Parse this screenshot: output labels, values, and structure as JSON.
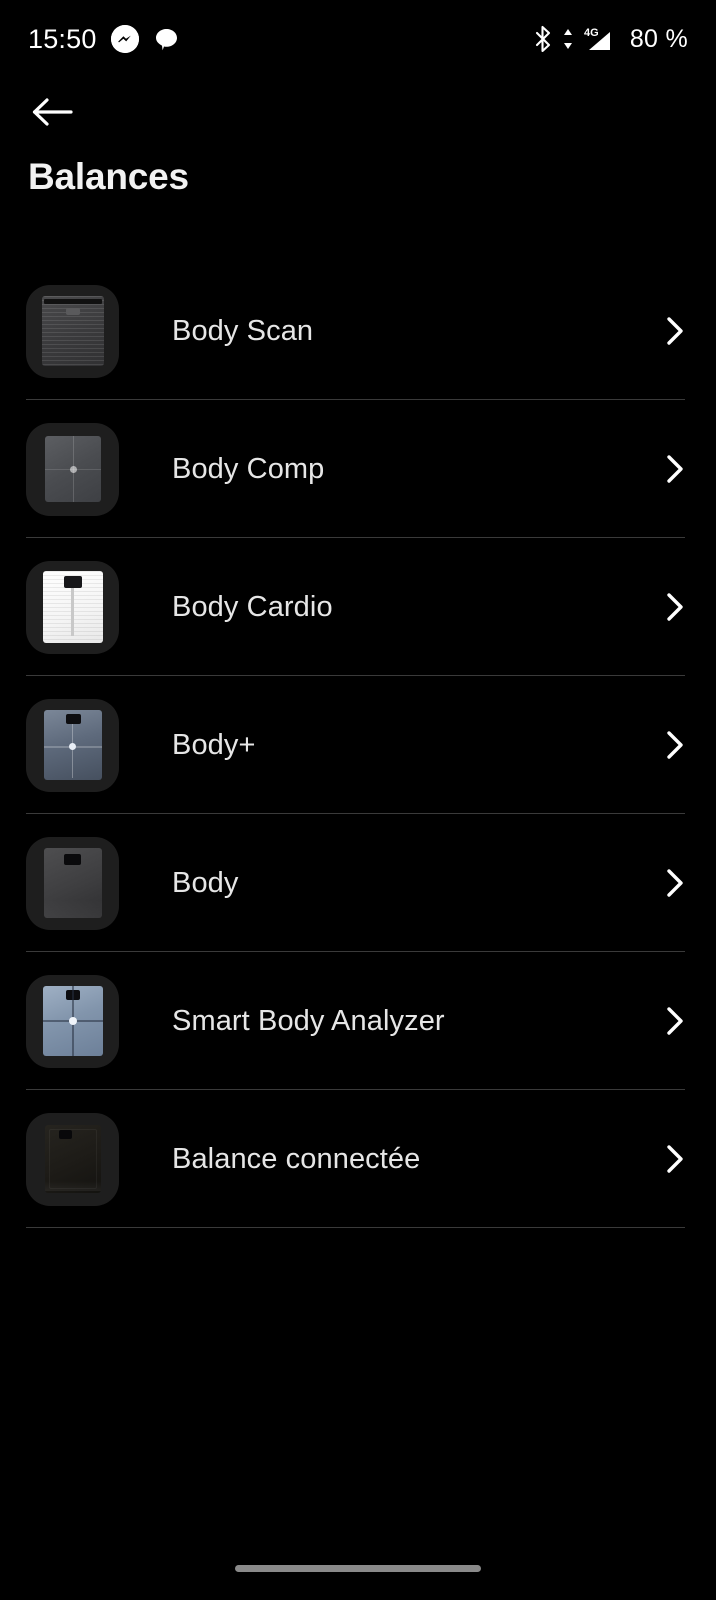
{
  "status_bar": {
    "time": "15:50",
    "battery": "80 %",
    "network_type": "4G",
    "icons": [
      "messenger-icon",
      "chat-bubble-icon",
      "bluetooth-icon",
      "data-transfer-icon",
      "signal-icon"
    ]
  },
  "header": {
    "back_label": "back-arrow",
    "title": "Balances"
  },
  "list": {
    "items": [
      {
        "label": "Body Scan",
        "chevron": "›"
      },
      {
        "label": "Body Comp",
        "chevron": "›"
      },
      {
        "label": "Body Cardio",
        "chevron": "›"
      },
      {
        "label": "Body+",
        "chevron": "›"
      },
      {
        "label": "Body",
        "chevron": "›"
      },
      {
        "label": "Smart Body Analyzer",
        "chevron": "›"
      },
      {
        "label": "Balance connectée",
        "chevron": "›"
      }
    ]
  },
  "colors": {
    "background": "#000000",
    "text_primary": "#e6e6e6",
    "title": "#f2f2f2",
    "divider": "#3a3a3a",
    "thumb_bg": "#1e1e1e",
    "home_indicator": "#8a8a8a"
  }
}
